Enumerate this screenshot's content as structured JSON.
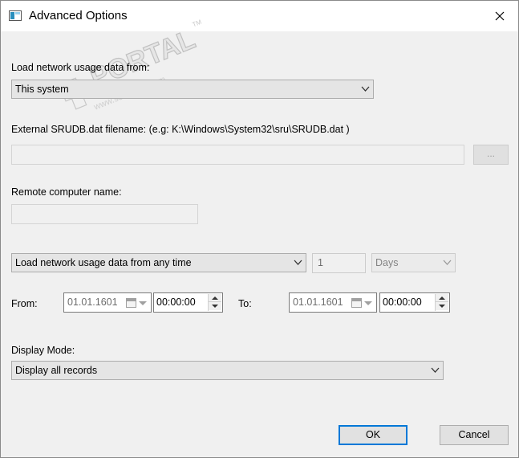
{
  "window": {
    "title": "Advanced Options",
    "close_icon": "close-icon",
    "app_icon": "app-window-icon"
  },
  "watermark": {
    "brand": "PORTAL",
    "trademark": "TM",
    "url": "www.softportal.com"
  },
  "source": {
    "label": "Load network usage data from:",
    "selected": "This system"
  },
  "external_file": {
    "label": "External SRUDB.dat filename: (e.g: K:\\Windows\\System32\\sru\\SRUDB.dat )",
    "value": "",
    "browse_label": "..."
  },
  "remote": {
    "label": "Remote computer name:",
    "value": ""
  },
  "time_filter": {
    "selected": "Load network usage data from any time",
    "count": "1",
    "unit": "Days"
  },
  "range": {
    "from_label": "From:",
    "from_date": "01.01.1601",
    "from_time": "00:00:00",
    "to_label": "To:",
    "to_date": "01.01.1601",
    "to_time": "00:00:00"
  },
  "display_mode": {
    "label": "Display Mode:",
    "selected": "Display all records"
  },
  "buttons": {
    "ok": "OK",
    "cancel": "Cancel"
  },
  "colors": {
    "accent": "#0078d7",
    "dialog_bg": "#f0f0f0",
    "titlebar_bg": "#ffffff"
  }
}
